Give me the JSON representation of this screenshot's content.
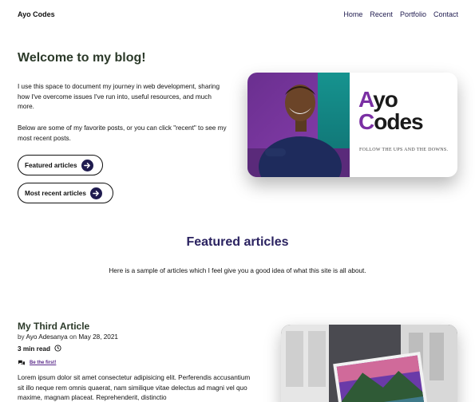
{
  "nav": {
    "brand": "Ayo Codes",
    "links": [
      {
        "label": "Home"
      },
      {
        "label": "Recent"
      },
      {
        "label": "Portfolio"
      },
      {
        "label": "Contact"
      }
    ]
  },
  "hero": {
    "title": "Welcome to my blog!",
    "paragraph1": "I use this space to document my journey in web development, sharing how I've overcome issues I've run into, useful resources, and much more.",
    "paragraph2": "Below are some of my favorite posts, or you can click \"recent\" to see my most recent posts.",
    "buttons": {
      "featured": "Featured articles",
      "recent": "Most recent articles"
    },
    "card": {
      "brand_first_a": "A",
      "brand_rest_a": "yo",
      "brand_first_c": "C",
      "brand_rest_c": "odes",
      "tagline": "FOLLOW THE UPS AND THE DOWNS."
    }
  },
  "featured": {
    "title": "Featured articles",
    "subtitle": "Here is a sample of articles which I feel give you a good idea of what this site is all about."
  },
  "article": {
    "title": "My Third Article",
    "by": "by",
    "author": "Ayo Adesanya",
    "on": "on",
    "date": "May 28, 2021",
    "read_time": "3 min read",
    "comments_link": "Be the first!",
    "body": "Lorem ipsum dolor sit amet consectetur adipisicing elit. Perferendis accusantium sit illo neque rem omnis quaerat, nam similique vitae delectus ad magni vel quo maxime, magnam placeat. Reprehenderit, distinctio"
  },
  "colors": {
    "accent": "#1f1b4f",
    "brand_purple": "#7a2fa3",
    "title_green": "#2c3a2a",
    "section_title": "#2a2260"
  },
  "icons": [
    "arrow-right-icon",
    "clock-icon",
    "comments-icon"
  ]
}
